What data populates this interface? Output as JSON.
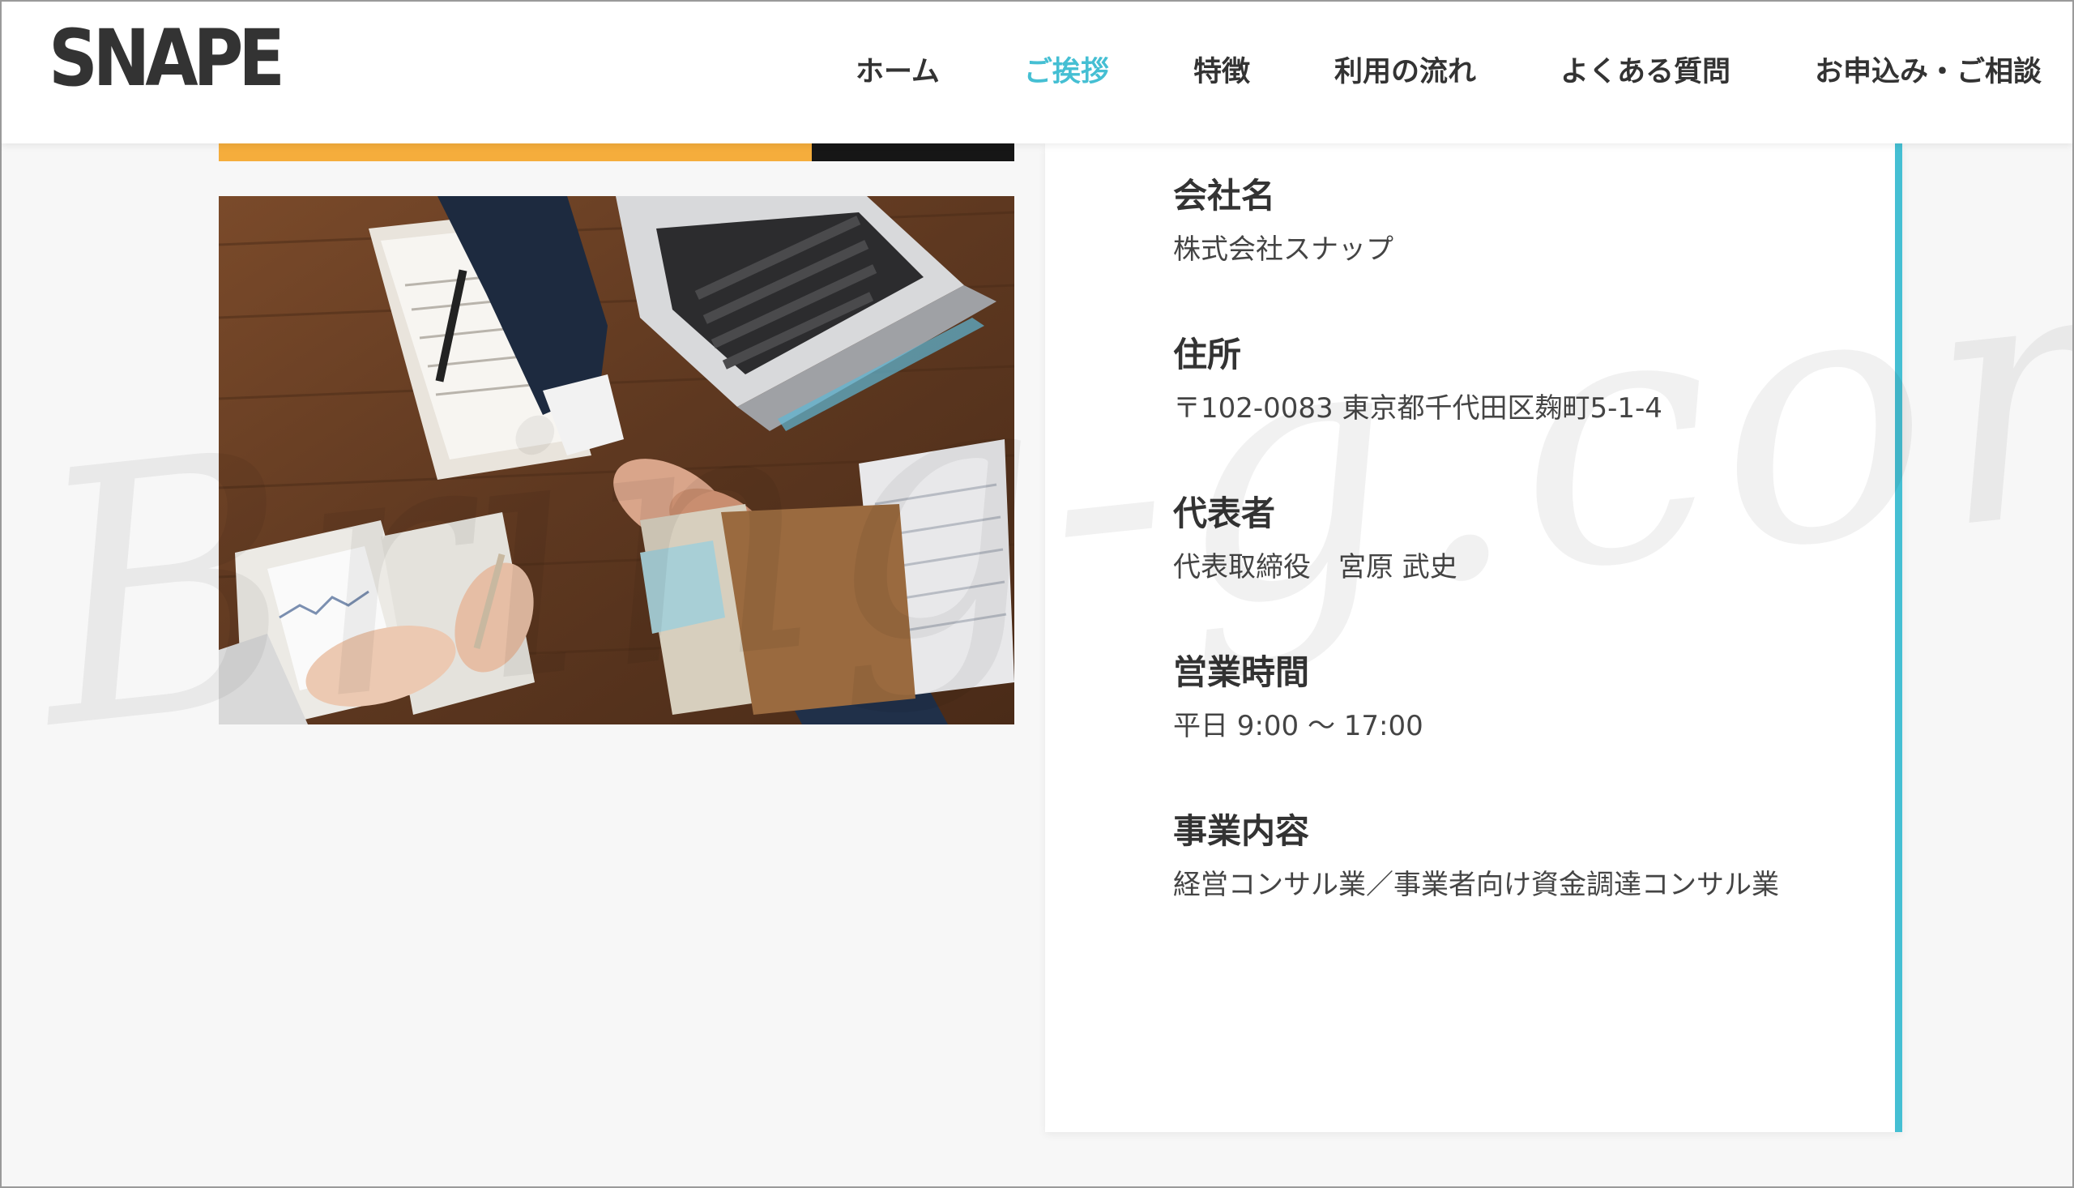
{
  "header": {
    "logo": "SNAPE",
    "nav": [
      {
        "label": "ホーム",
        "active": false
      },
      {
        "label": "ご挨拶",
        "active": true
      },
      {
        "label": "特徴",
        "active": false
      },
      {
        "label": "利用の流れ",
        "active": false
      },
      {
        "label": "よくある質問",
        "active": false
      },
      {
        "label": "お申込み・ご相談",
        "active": false
      }
    ]
  },
  "watermark": "Bring-g.com",
  "company_info": [
    {
      "label": "会社名",
      "value": "株式会社スナップ"
    },
    {
      "label": "住所",
      "value": "〒102-0083 東京都千代田区麹町5-1-4"
    },
    {
      "label": "代表者",
      "value": "代表取締役　宮原 武史"
    },
    {
      "label": "営業時間",
      "value": "平日 9:00 ～ 17:00"
    },
    {
      "label": "事業内容",
      "value": "経営コンサル業／事業者向け資金調達コンサル業"
    }
  ],
  "colors": {
    "accent": "#45bfd3",
    "orange": "#f5ad3c",
    "text": "#333333",
    "background": "#f7f7f7"
  }
}
